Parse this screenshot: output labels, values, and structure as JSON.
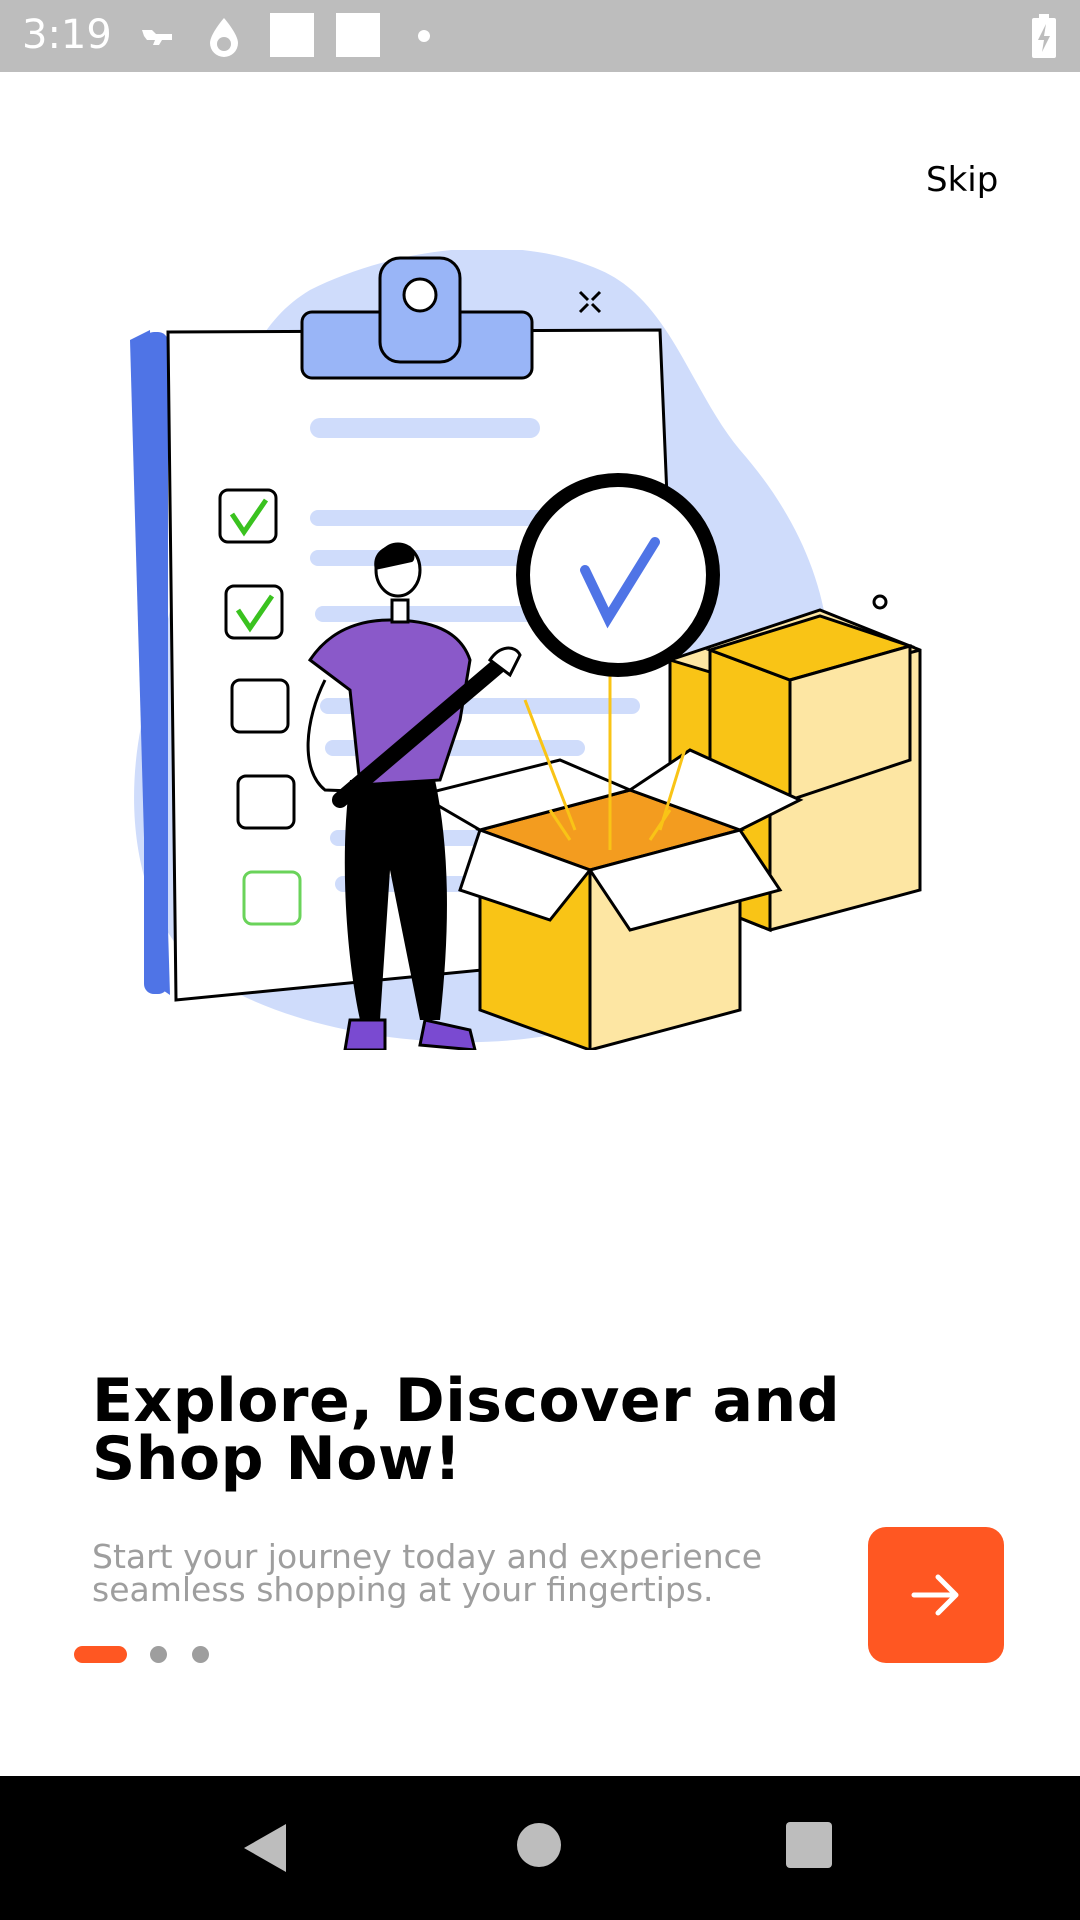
{
  "status_bar": {
    "time": "3:19",
    "icons": [
      "notification-icon",
      "water-drop-icon",
      "square-icon",
      "square-icon",
      "dot-icon",
      "battery-charging-icon"
    ]
  },
  "header": {
    "skip_label": "Skip"
  },
  "onboarding": {
    "title_line1": "Explore, Discover and",
    "title_line2": "Shop Now!",
    "subtitle_line1": "Start your journey today and experience",
    "subtitle_line2": "seamless shopping at your fingertips.",
    "page_count": 3,
    "active_page": 1,
    "next_icon": "arrow-right-icon"
  },
  "colors": {
    "accent": "#ff5722",
    "indicator_inactive": "#9e9e9e",
    "status_bar": "#bdbdbd",
    "nav_bar": "#000000"
  },
  "nav_bar": {
    "icons": [
      "back-icon",
      "home-icon",
      "recents-icon"
    ]
  }
}
